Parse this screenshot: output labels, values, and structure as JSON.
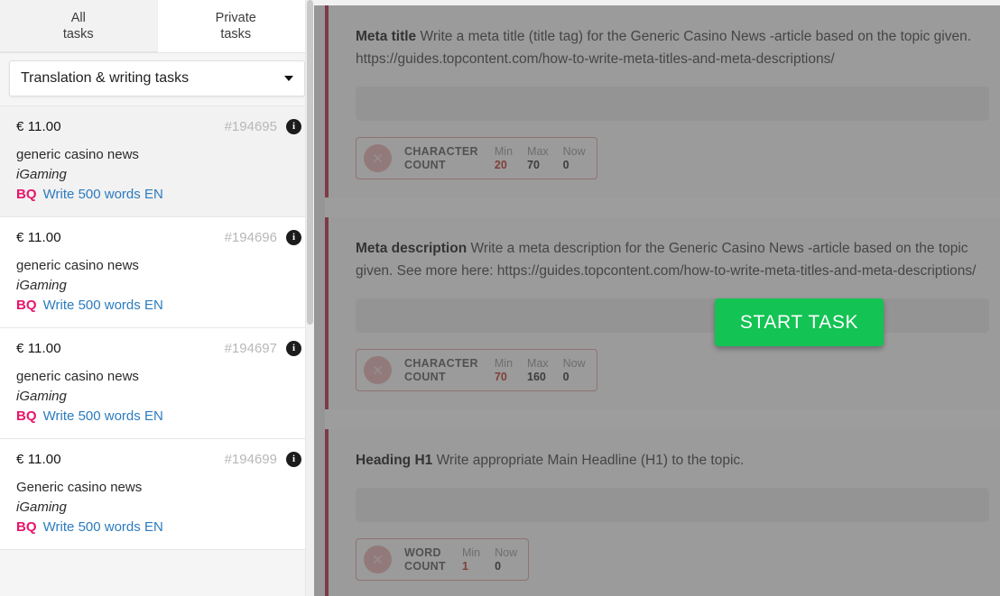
{
  "sidebar": {
    "tabs": [
      {
        "line1": "All",
        "line2": "tasks",
        "active": false
      },
      {
        "line1": "Private",
        "line2": "tasks",
        "active": true
      }
    ],
    "filter": {
      "selected": "Translation & writing tasks",
      "caret_icon": "chevron-down-icon"
    },
    "tasks": [
      {
        "price": "€ 11.00",
        "id": "#194695",
        "info_icon": "info-icon",
        "title": "generic casino news",
        "category": "iGaming",
        "badge": "BQ",
        "link": "Write 500 words EN",
        "selected": true
      },
      {
        "price": "€ 11.00",
        "id": "#194696",
        "info_icon": "info-icon",
        "title": "generic casino news",
        "category": "iGaming",
        "badge": "BQ",
        "link": "Write 500 words EN",
        "selected": false
      },
      {
        "price": "€ 11.00",
        "id": "#194697",
        "info_icon": "info-icon",
        "title": "generic casino news",
        "category": "iGaming",
        "badge": "BQ",
        "link": "Write 500 words EN",
        "selected": false
      },
      {
        "price": "€ 11.00",
        "id": "#194699",
        "info_icon": "info-icon",
        "title": "Generic casino news",
        "category": "iGaming",
        "badge": "BQ",
        "link": "Write 500 words EN",
        "selected": false
      }
    ]
  },
  "main": {
    "sections": [
      {
        "label": "Meta title",
        "prompt": " Write a meta title (title tag) for the Generic Casino News -article based on the topic given. https://guides.topcontent.com/how-to-write-meta-titles-and-meta-descriptions/",
        "answer_value": "",
        "counter": {
          "name_line1": "CHARACTER",
          "name_line2": "COUNT",
          "status_icon": "x-circle-icon",
          "columns": [
            {
              "key": "Min",
              "value": "20",
              "alert": true
            },
            {
              "key": "Max",
              "value": "70",
              "alert": false
            },
            {
              "key": "Now",
              "value": "0",
              "alert": false
            }
          ]
        }
      },
      {
        "label": "Meta description",
        "prompt": " Write a meta description for the Generic Casino News -article based on the topic given. See more here: https://guides.topcontent.com/how-to-write-meta-titles-and-meta-descriptions/",
        "answer_value": "",
        "counter": {
          "name_line1": "CHARACTER",
          "name_line2": "COUNT",
          "status_icon": "x-circle-icon",
          "columns": [
            {
              "key": "Min",
              "value": "70",
              "alert": true
            },
            {
              "key": "Max",
              "value": "160",
              "alert": false
            },
            {
              "key": "Now",
              "value": "0",
              "alert": false
            }
          ]
        }
      },
      {
        "label": "Heading H1",
        "prompt": " Write appropriate Main Headline (H1) to the topic.",
        "answer_value": "",
        "counter": {
          "name_line1": "WORD",
          "name_line2": "COUNT",
          "status_icon": "x-circle-icon",
          "columns": [
            {
              "key": "Min",
              "value": "1",
              "alert": true
            },
            {
              "key": "Now",
              "value": "0",
              "alert": false
            }
          ]
        }
      }
    ],
    "start_task_label": "START TASK"
  },
  "colors": {
    "accent_green": "#13c353",
    "badge_pink": "#e8156b",
    "link_blue": "#2b7bbf",
    "card_border_red": "#c02e4c",
    "alert_red": "#c0392b"
  }
}
